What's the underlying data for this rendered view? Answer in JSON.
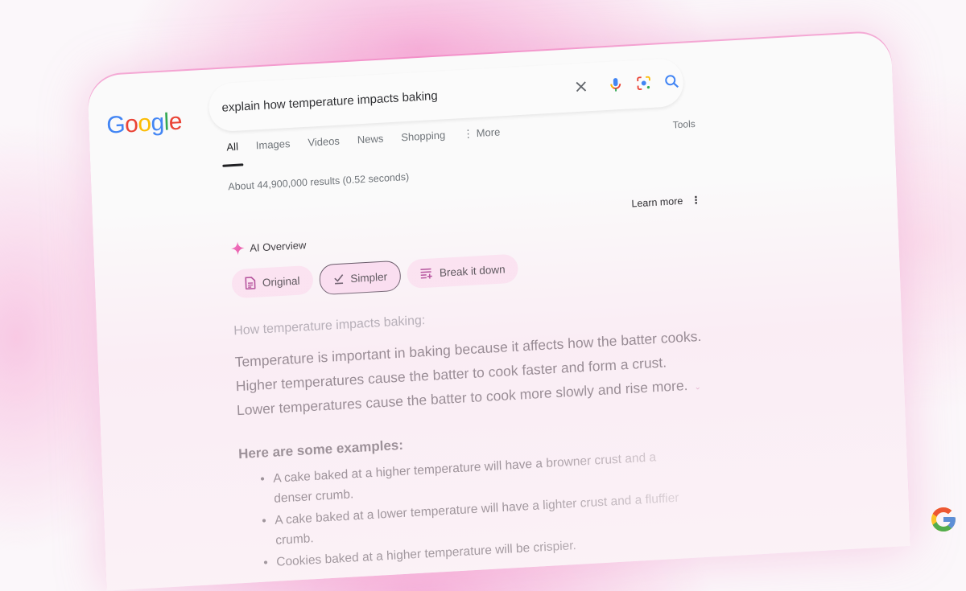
{
  "brand": {
    "logo_letters": [
      {
        "char": "G",
        "color": "#4285F4"
      },
      {
        "char": "o",
        "color": "#EA4335"
      },
      {
        "char": "o",
        "color": "#FBBC05"
      },
      {
        "char": "g",
        "color": "#4285F4"
      },
      {
        "char": "l",
        "color": "#34A853"
      },
      {
        "char": "e",
        "color": "#EA4335"
      }
    ]
  },
  "search": {
    "query": "explain how temperature impacts baking",
    "icons": [
      "close-icon",
      "microphone-icon",
      "lens-icon",
      "search-icon"
    ]
  },
  "tabs": [
    {
      "label": "All",
      "active": true
    },
    {
      "label": "Images",
      "active": false
    },
    {
      "label": "Videos",
      "active": false
    },
    {
      "label": "News",
      "active": false
    },
    {
      "label": "Shopping",
      "active": false
    },
    {
      "label": "More",
      "active": false
    }
  ],
  "tools_label": "Tools",
  "results_stats": "About 44,900,000 results (0.52 seconds)",
  "ai_overview": {
    "title": "AI Overview",
    "learn_more": "Learn more",
    "chips": [
      {
        "label": "Original",
        "icon": "document-icon",
        "selected": false
      },
      {
        "label": "Simpler",
        "icon": "check-icon",
        "selected": true
      },
      {
        "label": "Break it down",
        "icon": "list-add-icon",
        "selected": false
      }
    ],
    "subtitle": "How temperature impacts baking:",
    "lines": [
      "Temperature is important in baking because it affects how the batter cooks.",
      "Higher temperatures cause the batter to cook faster and form a crust.",
      "Lower temperatures cause the batter to cook more slowly and rise more."
    ],
    "examples_heading": "Here are some examples:",
    "examples": [
      "A cake baked at a higher temperature will have a browner crust and a denser crumb.",
      "A cake baked at a lower temperature will have a lighter crust and a fluffier crumb.",
      "Cookies baked at a higher temperature will be crispier."
    ]
  },
  "colors": {
    "accent_pink": "#E94BA0",
    "chip_bg": "#FBE3F1",
    "chip_icon": "#9C1E7E"
  }
}
